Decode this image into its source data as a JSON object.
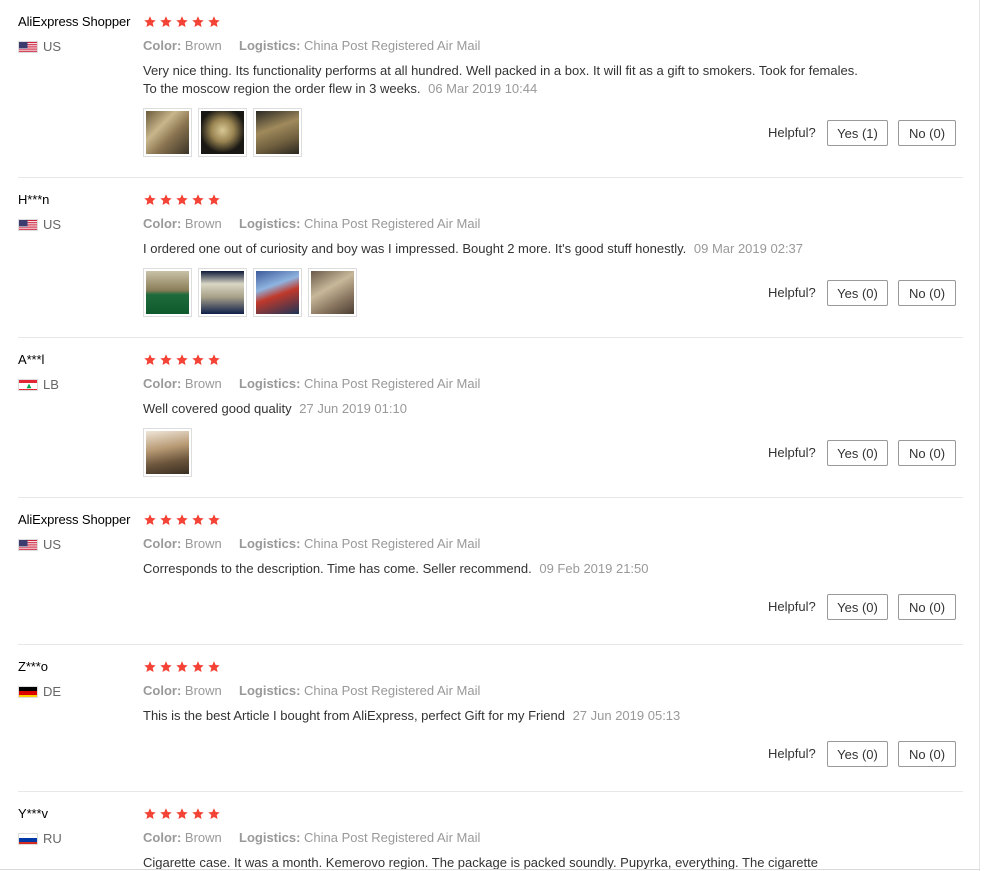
{
  "labels": {
    "color_key": "Color:",
    "logistics_key": "Logistics:",
    "helpful": "Helpful?"
  },
  "colors": {
    "star": "#f44336"
  },
  "reviews": [
    {
      "name": "AliExpress Shopper",
      "country": "US",
      "flag": "us",
      "stars": 5,
      "color": "Brown",
      "logistics": "China Post Registered Air Mail",
      "text": "Very nice thing. Its functionality performs at all hundred. Well packed in a box. It will fit as a gift to smokers. Took for females. To the moscow region the order flew in 3 weeks.",
      "date": "06 Mar 2019 10:44",
      "photos": [
        "photo-brass-case-open",
        "photo-brass-case-dark",
        "photo-brass-case-closed"
      ],
      "yes": "Yes (1)",
      "no": "No (0)"
    },
    {
      "name": "H***n",
      "country": "US",
      "flag": "us",
      "stars": 5,
      "color": "Brown",
      "logistics": "China Post Registered Air Mail",
      "text": "I ordered one out of curiosity and boy was I impressed. Bought 2 more. It's good stuff honestly.",
      "date": "09 Mar 2019 02:37",
      "photos": [
        "photo-case-on-green",
        "photo-case-on-blue",
        "photo-case-artwork",
        "photo-case-angle"
      ],
      "yes": "Yes (0)",
      "no": "No (0)"
    },
    {
      "name": "A***l",
      "country": "LB",
      "flag": "lb",
      "stars": 5,
      "color": "Brown",
      "logistics": "China Post Registered Air Mail",
      "text": "Well covered good quality",
      "date": "27 Jun 2019 01:10",
      "photos": [
        "photo-case-in-hand"
      ],
      "yes": "Yes (0)",
      "no": "No (0)"
    },
    {
      "name": "AliExpress Shopper",
      "country": "US",
      "flag": "us",
      "stars": 5,
      "color": "Brown",
      "logistics": "China Post Registered Air Mail",
      "text": "Corresponds to the description. Time has come. Seller recommend.",
      "date": "09 Feb 2019 21:50",
      "photos": [],
      "yes": "Yes (0)",
      "no": "No (0)"
    },
    {
      "name": "Z***o",
      "country": "DE",
      "flag": "de",
      "stars": 5,
      "color": "Brown",
      "logistics": "China Post Registered Air Mail",
      "text": "This is the best Article I bought from AliExpress, perfect Gift for my Friend",
      "date": "27 Jun 2019 05:13",
      "photos": [],
      "yes": "Yes (0)",
      "no": "No (0)"
    },
    {
      "name": "Y***v",
      "country": "RU",
      "flag": "ru",
      "stars": 5,
      "color": "Brown",
      "logistics": "China Post Registered Air Mail",
      "text": "Cigarette case. It was a month. Kemerovo region. The package is packed soundly. Pupyrka, everything. The cigarette",
      "date": "",
      "photos": [],
      "yes": "",
      "no": ""
    }
  ]
}
